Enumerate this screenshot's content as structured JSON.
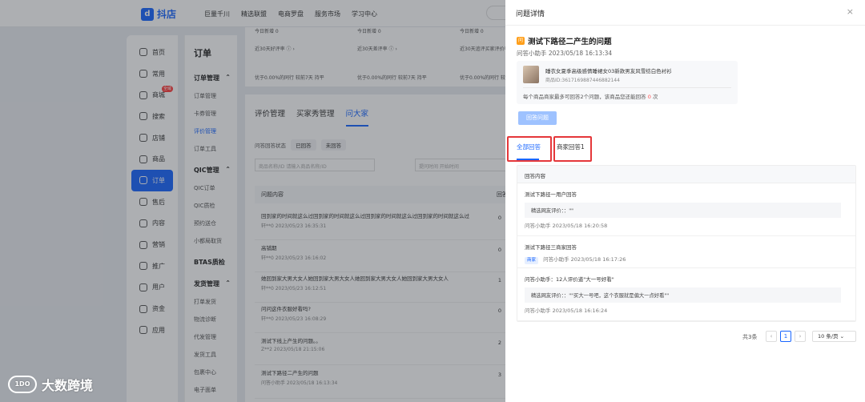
{
  "app": {
    "logo_text": "抖店",
    "nav": [
      "巨量千川",
      "精选联盟",
      "电商罗盘",
      "服务市场",
      "学习中心"
    ]
  },
  "sidebar": {
    "items": [
      {
        "label": "首页",
        "icon": "home-icon"
      },
      {
        "label": "常用",
        "icon": "star-icon"
      },
      {
        "label": "商城",
        "icon": "mall-icon",
        "badge": "全域"
      },
      {
        "label": "搜索",
        "icon": "search-icon"
      },
      {
        "label": "店铺",
        "icon": "store-icon"
      },
      {
        "label": "商品",
        "icon": "product-icon"
      },
      {
        "label": "订单",
        "icon": "order-icon",
        "active": true
      },
      {
        "label": "售后",
        "icon": "aftersale-icon"
      },
      {
        "label": "内容",
        "icon": "content-icon"
      },
      {
        "label": "营销",
        "icon": "marketing-icon"
      },
      {
        "label": "推广",
        "icon": "promo-icon"
      },
      {
        "label": "用户",
        "icon": "user-icon"
      },
      {
        "label": "资金",
        "icon": "funds-icon"
      },
      {
        "label": "应用",
        "icon": "apps-icon"
      }
    ]
  },
  "subnav": {
    "title": "订单",
    "groups": [
      {
        "label": "订单管理",
        "items": [
          "订单管理",
          "卡券管理",
          "评价管理",
          "订单工具"
        ]
      },
      {
        "label": "QIC管理",
        "items": [
          "QIC订单",
          "QIC质检",
          "预约送仓",
          "小都局取货"
        ]
      },
      {
        "label": "BTAS质检",
        "items": []
      },
      {
        "label": "发货管理",
        "items": [
          "打单发货",
          "物流诊断",
          "代发管理",
          "发货工具",
          "包裹中心",
          "电子面单"
        ]
      }
    ]
  },
  "stats": [
    {
      "label": "近30天好评率 ⓘ ›",
      "sub": "优于0.00%的同行  较前7天 持平",
      "top": "今日新增 0"
    },
    {
      "label": "近30天差评率 ⓘ ›",
      "sub": "优于0.00%的同行  较前7天 持平",
      "top": "今日新增 0"
    },
    {
      "label": "近30天追评买家评价率 ⓘ ›",
      "sub": "优于0.00%的同行  较前7天 持平",
      "top": "今日新增 0"
    }
  ],
  "main": {
    "tabs": [
      "评价管理",
      "买家秀管理",
      "问大家"
    ],
    "filter_label": "问答回答状态",
    "filter_pills": [
      "已回答",
      "未回答"
    ],
    "search_placeholder": "商品名称/ID   请输入商品名称/ID",
    "time_label": "提问时间   开始时间",
    "table_header": "问题内容",
    "table_header_right": "回答",
    "rows": [
      {
        "text": "回到家的时间就这么过回到家的时间就这么过回到家的时间就这么过回到家的时间就这么过",
        "meta": "轩**0  2023/05/23 16:35:31",
        "n": "0"
      },
      {
        "text": "高铺期",
        "meta": "轩**0  2023/05/23 16:16:02",
        "n": "0"
      },
      {
        "text": "她回到家大男大女人她回到家大男大女人她回到家大男大女人她回到家大男大女人",
        "meta": "轩**0  2023/05/23 16:12:51",
        "n": "1"
      },
      {
        "text": "问问这件衣服好看吗?",
        "meta": "轩**0  2023/05/23 16:08:29",
        "n": "0"
      },
      {
        "text": "测试下线上产生的问题。。",
        "meta": "Z**2  2023/05/18 21:15:06",
        "n": "2"
      },
      {
        "text": "测试下路径二产生的问题",
        "meta": "问答小助手  2023/05/18 16:13:34",
        "n": "3"
      }
    ]
  },
  "drawer": {
    "title": "问题详情",
    "close": "×",
    "question_icon": "问",
    "question": "测试下路径二产生的问题",
    "question_meta": "问答小助手  2023/05/18 16:13:34",
    "product_name": "睡衣女夏季高级感情睡裙女03新款男友风雪纺白色衬衫",
    "product_id": "商品ID:3617169887446882144",
    "note_pre": "每个商品商家最多可回答2个问题，该商品您还能回答",
    "note_num": "0",
    "note_post": "次",
    "answer_button": "回答问题",
    "tabs": [
      "全部回答",
      "商家回答1"
    ],
    "list_header": "回答内容",
    "answers": [
      {
        "title": "测试下路径一用户回答",
        "quote": "精选网友评价：：\"\"",
        "tag": "",
        "meta": "问答小助手  2023/05/18 16:20:58"
      },
      {
        "title": "测试下路径三商家回答",
        "quote": "",
        "tag": "商家",
        "meta": "问答小助手  2023/05/18 16:17:26"
      },
      {
        "title": "问答小助手：12人评价道\"大一号好看\"",
        "quote": "精选网友评价：：\"\"买大一号吧，这个衣服就是偏大一点好看\"\"",
        "tag": "",
        "meta": "问答小助手  2023/05/18 16:16:24"
      }
    ],
    "pager": {
      "total": "共3条",
      "prev": "‹",
      "current": "1",
      "next": "›",
      "size": "10 条/页 ⌄"
    }
  },
  "watermark": {
    "icon": "1DO",
    "text": "大数跨境"
  }
}
